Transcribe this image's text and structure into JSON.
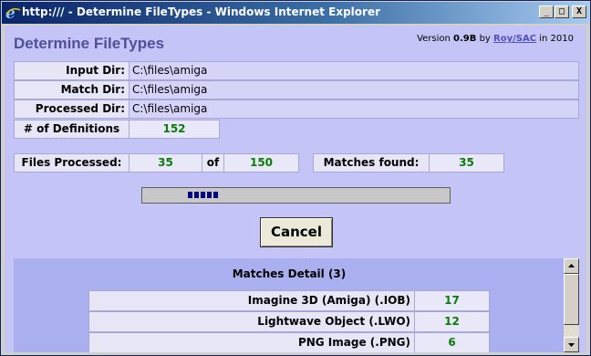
{
  "window": {
    "title": "http:/// - Determine FileTypes - Windows Internet Explorer"
  },
  "titlebar_buttons": {
    "minimize": "_",
    "maximize": "□",
    "close": "X"
  },
  "app": {
    "title": "Determine FileTypes",
    "version_prefix": "Version",
    "version": "0.9B",
    "by": "by",
    "author": "Roy/SAC",
    "year_text": "in 2010"
  },
  "dirs": {
    "input_label": "Input Dir:",
    "input_value": "C:\\files\\amiga",
    "match_label": "Match Dir:",
    "match_value": "C:\\files\\amiga",
    "processed_label": "Processed Dir:",
    "processed_value": "C:\\files\\amiga"
  },
  "definitions": {
    "label": "# of Definitions",
    "value": "152"
  },
  "progress": {
    "files_label": "Files Processed:",
    "processed": "35",
    "of_label": "of",
    "total": "150",
    "matches_label": "Matches found:",
    "matches": "35",
    "bar_fraction": 0.233
  },
  "buttons": {
    "cancel": "Cancel"
  },
  "details": {
    "title": "Matches Detail (3)",
    "rows": [
      {
        "name": "Imagine 3D (Amiga) (.IOB)",
        "count": "17"
      },
      {
        "name": "Lightwave Object (.LWO)",
        "count": "12"
      },
      {
        "name": "PNG Image (.PNG)",
        "count": "6"
      }
    ]
  },
  "colors": {
    "accent": "#50509a",
    "background": "#c4c4f6",
    "count_green": "#0a7a0a",
    "progress_block": "#000080"
  }
}
